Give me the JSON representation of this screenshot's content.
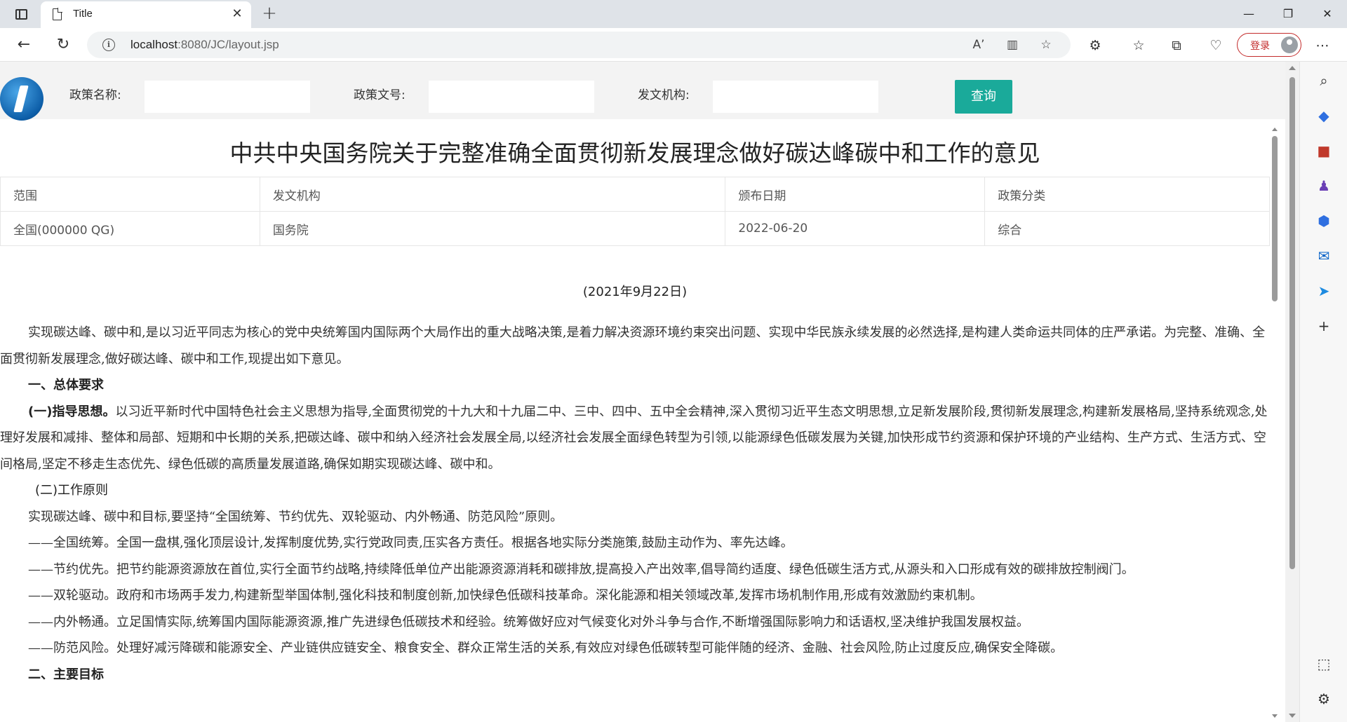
{
  "browser": {
    "tab_title": "Title",
    "tab_close": "✕",
    "new_tab": "+",
    "url_host": "localhost",
    "url_path": ":8080/JC/layout.jsp",
    "login_label": "登录"
  },
  "search": {
    "policy_name_label": "政策名称:",
    "policy_number_label": "政策文号:",
    "issuing_org_label": "发文机构:",
    "policy_name_value": "",
    "policy_number_value": "",
    "issuing_org_value": "",
    "query_button": "查询"
  },
  "document": {
    "title": "中共中央国务院关于完整准确全面贯彻新发展理念做好碳达峰碳中和工作的意见",
    "meta_headers": [
      "范围",
      "发文机构",
      "颁布日期",
      "政策分类"
    ],
    "meta_values": [
      "全国(000000 QG)",
      "国务院",
      "2022-06-20",
      "综合"
    ],
    "date_line": "(2021年9月22日)",
    "p1": "实现碳达峰、碳中和,是以习近平同志为核心的党中央统筹国内国际两个大局作出的重大战略决策,是着力解决资源环境约束突出问题、实现中华民族永续发展的必然选择,是构建人类命运共同体的庄严承诺。为完整、准确、全面贯彻新发展理念,做好碳达峰、碳中和工作,现提出如下意见。",
    "h1": "一、总体要求",
    "s1_lead": "(一)指导思想。",
    "s1_body": "以习近平新时代中国特色社会主义思想为指导,全面贯彻党的十九大和十九届二中、三中、四中、五中全会精神,深入贯彻习近平生态文明思想,立足新发展阶段,贯彻新发展理念,构建新发展格局,坚持系统观念,处理好发展和减排、整体和局部、短期和中长期的关系,把碳达峰、碳中和纳入经济社会发展全局,以经济社会发展全面绿色转型为引领,以能源绿色低碳发展为关键,加快形成节约资源和保护环境的产业结构、生产方式、生活方式、空间格局,坚定不移走生态优先、绿色低碳的高质量发展道路,确保如期实现碳达峰、碳中和。",
    "s2_head": "(二)工作原则",
    "p2": "实现碳达峰、碳中和目标,要坚持“全国统筹、节约优先、双轮驱动、内外畅通、防范风险”原则。",
    "p3": "——全国统筹。全国一盘棋,强化顶层设计,发挥制度优势,实行党政同责,压实各方责任。根据各地实际分类施策,鼓励主动作为、率先达峰。",
    "p4": "——节约优先。把节约能源资源放在首位,实行全面节约战略,持续降低单位产出能源资源消耗和碳排放,提高投入产出效率,倡导简约适度、绿色低碳生活方式,从源头和入口形成有效的碳排放控制阀门。",
    "p5": "——双轮驱动。政府和市场两手发力,构建新型举国体制,强化科技和制度创新,加快绿色低碳科技革命。深化能源和相关领域改革,发挥市场机制作用,形成有效激励约束机制。",
    "p6": "——内外畅通。立足国情实际,统筹国内国际能源资源,推广先进绿色低碳技术和经验。统筹做好应对气候变化对外斗争与合作,不断增强国际影响力和话语权,坚决维护我国发展权益。",
    "p7": "——防范风险。处理好减污降碳和能源安全、产业链供应链安全、粮食安全、群众正常生活的关系,有效应对绿色低碳转型可能伴随的经济、金融、社会风险,防止过度反应,确保安全降碳。",
    "h2": "二、主要目标"
  }
}
